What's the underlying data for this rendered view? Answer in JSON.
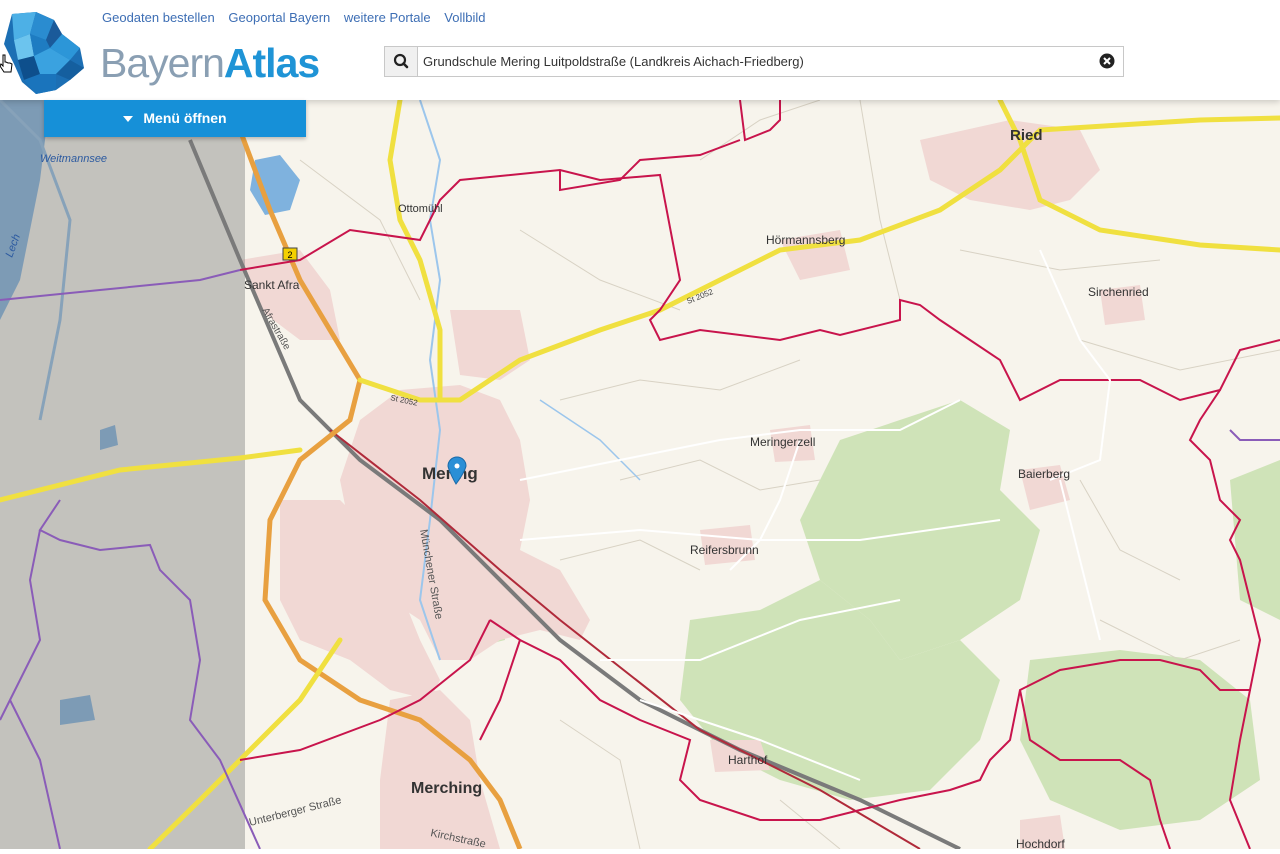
{
  "header": {
    "links": [
      "Geodaten bestellen",
      "Geoportal Bayern",
      "weitere Portale",
      "Vollbild"
    ],
    "logo_part1": "Bayern",
    "logo_part2": "Atlas",
    "search_value": "Grundschule Mering Luitpoldstraße (Landkreis Aichach-Friedberg)"
  },
  "menu": {
    "label": "Menü öffnen"
  },
  "map": {
    "places": [
      {
        "name": "Ried",
        "kind": "town"
      },
      {
        "name": "Hörmannsberg",
        "kind": "village"
      },
      {
        "name": "Sirchenried",
        "kind": "village"
      },
      {
        "name": "Ottomühl",
        "kind": "village"
      },
      {
        "name": "Sankt Afra",
        "kind": "village"
      },
      {
        "name": "Mering",
        "kind": "town"
      },
      {
        "name": "Meringerzell",
        "kind": "village"
      },
      {
        "name": "Baierberg",
        "kind": "village"
      },
      {
        "name": "Reifersbrunn",
        "kind": "village"
      },
      {
        "name": "Harthof",
        "kind": "village"
      },
      {
        "name": "Merching",
        "kind": "town"
      },
      {
        "name": "Hochdorf",
        "kind": "village"
      },
      {
        "name": "Weitmannsee",
        "kind": "water"
      },
      {
        "name": "Lech",
        "kind": "water"
      }
    ],
    "streets": [
      "Afrastraße",
      "Münchener Straße",
      "Unterberger Straße",
      "Kirchstraße",
      "St 2052",
      "St 2052"
    ],
    "road_badge": "2",
    "colors": {
      "road_yellow": "#f0e040",
      "highway_orange": "#e8a040",
      "border_red": "#c8144c",
      "rail": "#7a7a7a",
      "forest": "#cfe3b8",
      "settlement": "#f1d8d4",
      "water": "#7fb2de"
    }
  }
}
